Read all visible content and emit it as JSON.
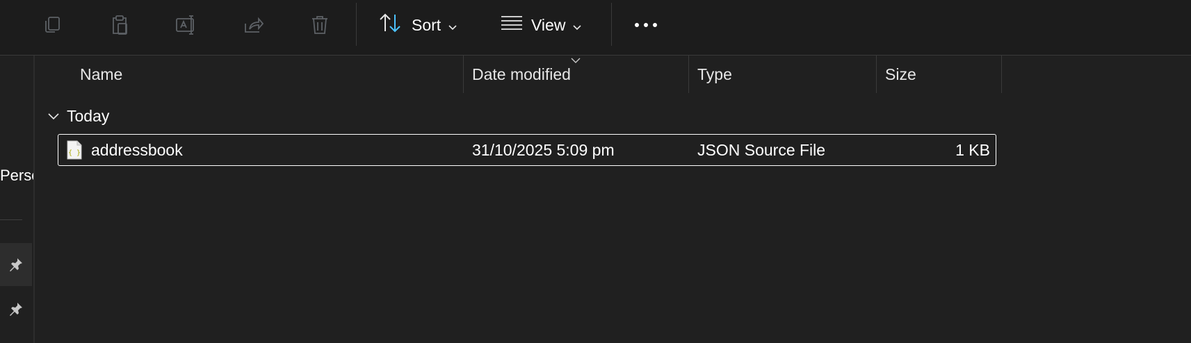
{
  "toolbar": {
    "icons": [
      "copy-icon",
      "paste-icon",
      "rename-icon",
      "share-icon",
      "delete-icon"
    ],
    "sort_label": "Sort",
    "view_label": "View",
    "more_label": "•••"
  },
  "leftnav": {
    "partial_label": "Perso"
  },
  "columns": {
    "name": "Name",
    "date_modified": "Date modified",
    "type": "Type",
    "size": "Size"
  },
  "group": {
    "label": "Today"
  },
  "files": [
    {
      "name": "addressbook",
      "date_modified": "31/10/2025 5:09 pm",
      "type": "JSON Source File",
      "size": "1 KB",
      "icon": "json-file-icon"
    }
  ],
  "colors": {
    "background": "#202020",
    "toolbar": "#1c1c1c",
    "disabled_icon": "#5d6166",
    "accent": "#4cc2ff"
  }
}
